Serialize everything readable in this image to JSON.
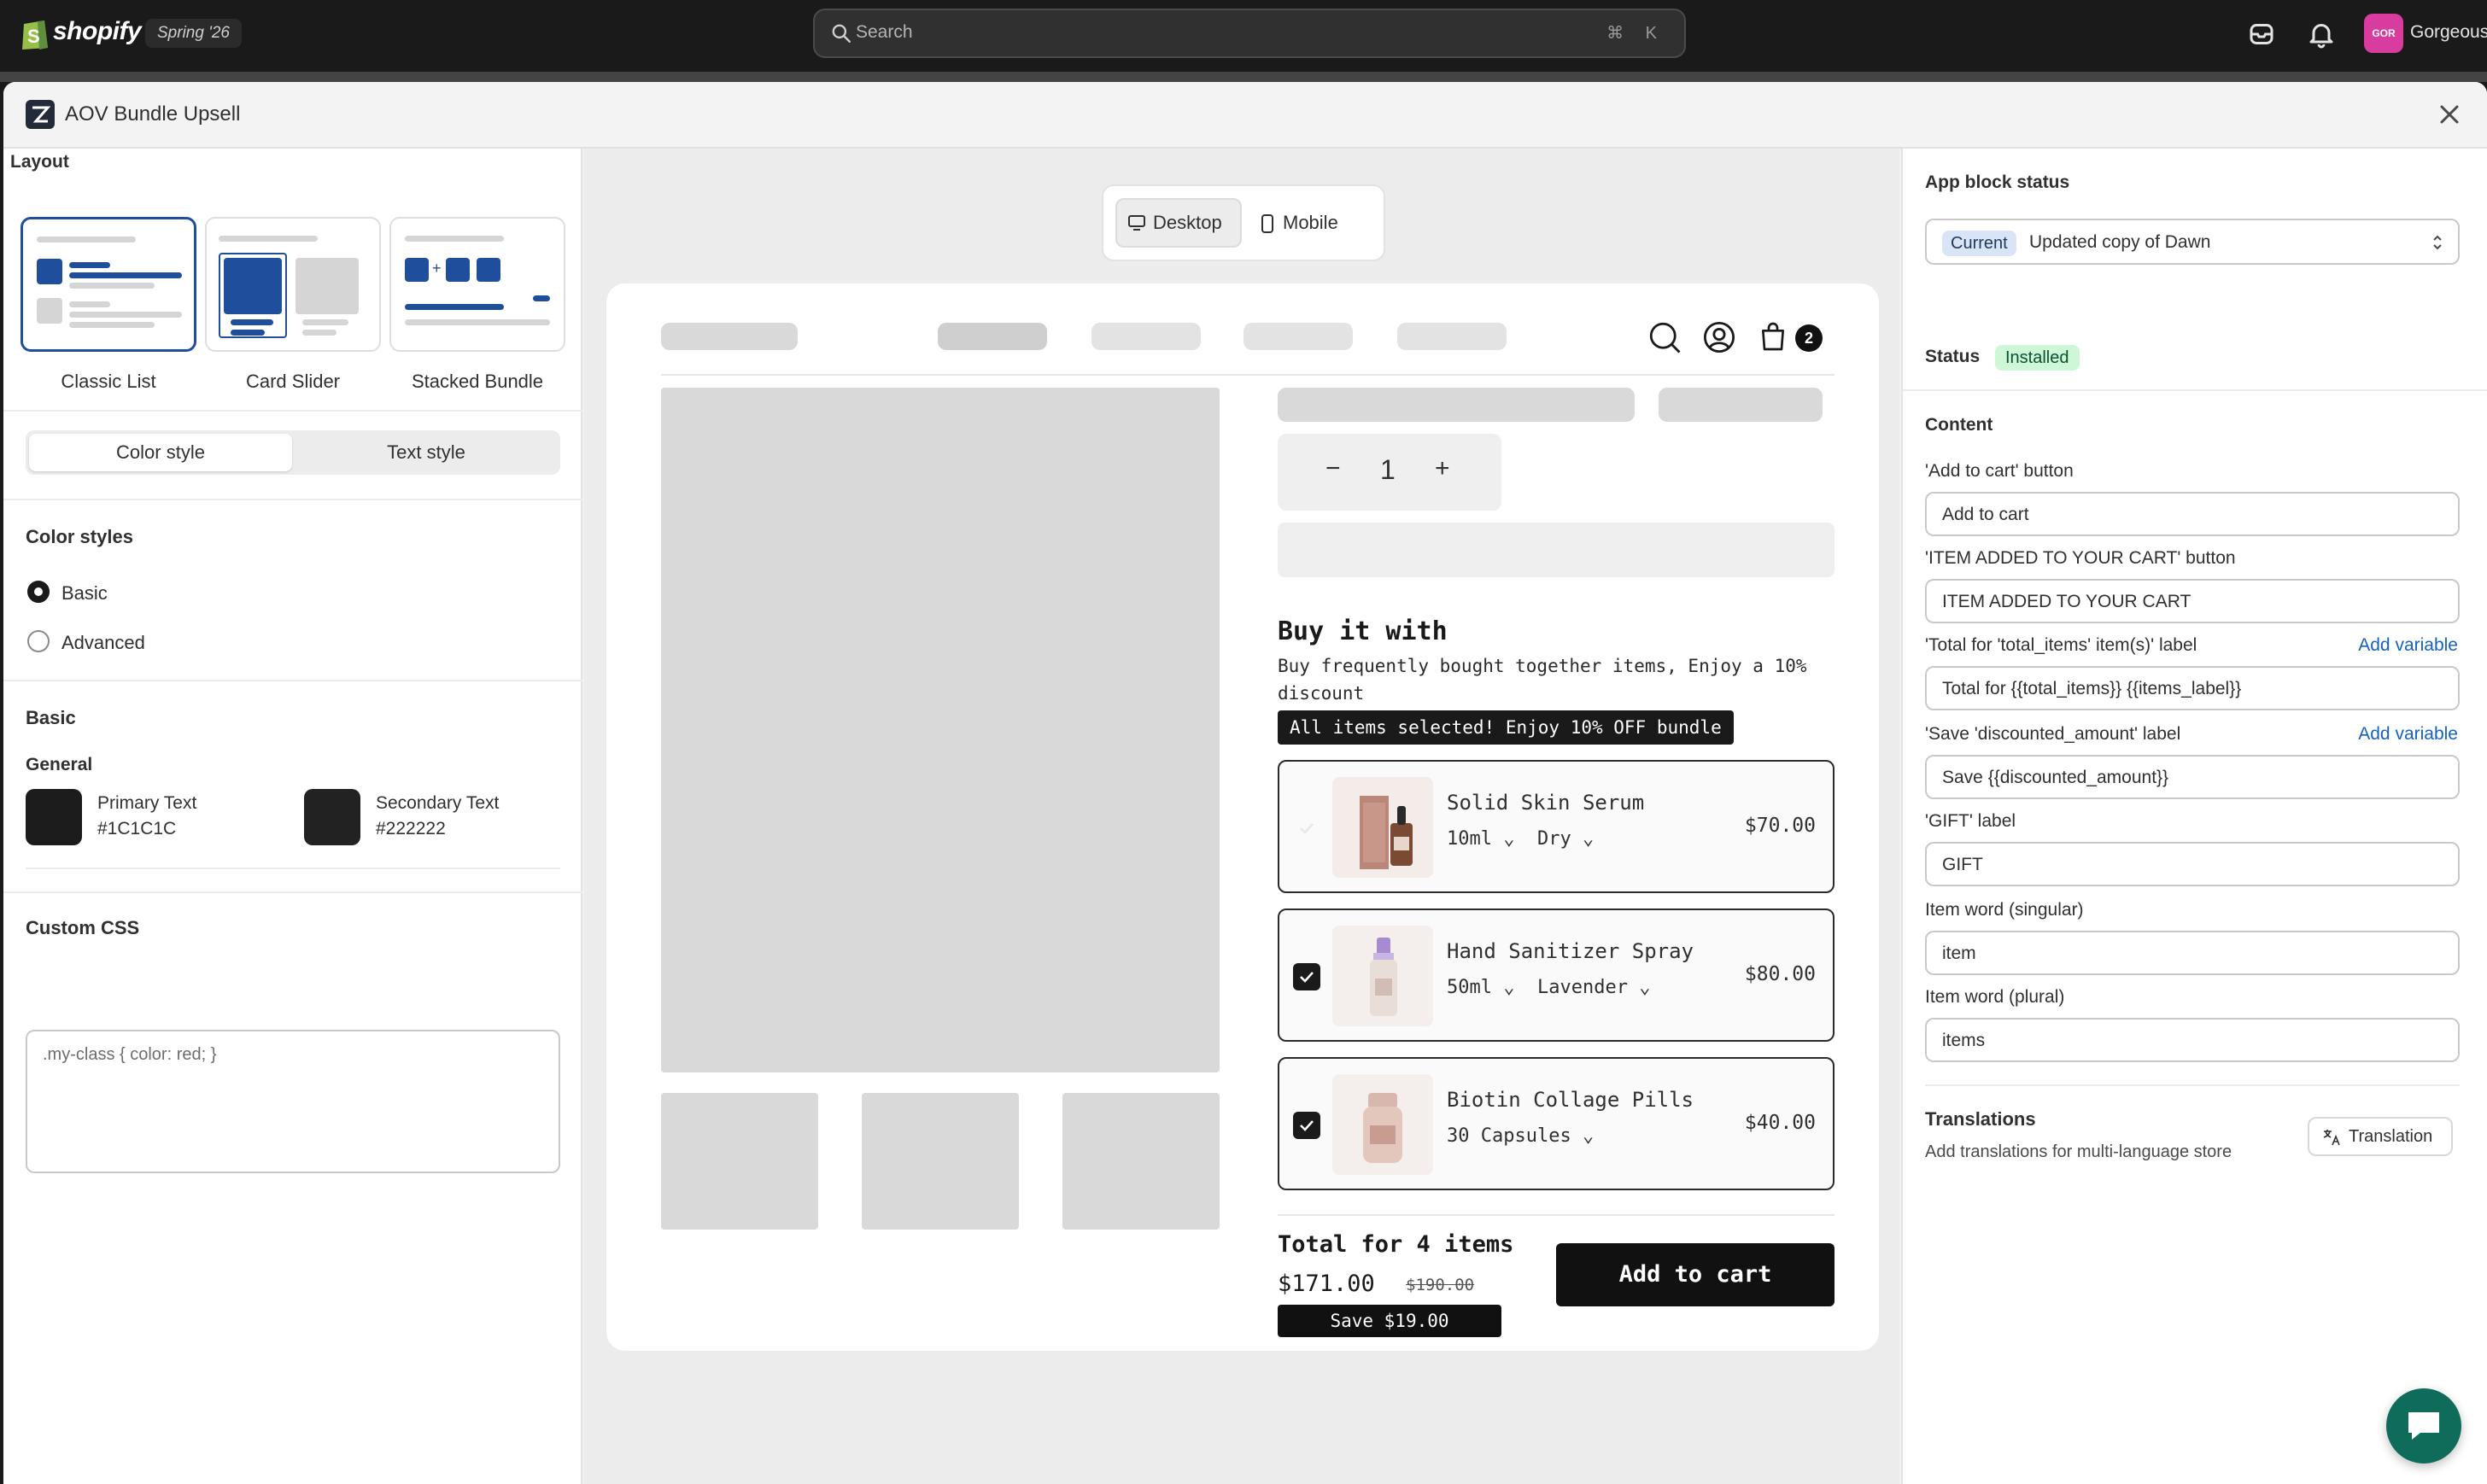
{
  "topbar": {
    "logo": "shopify",
    "edition": "Spring '26",
    "search_placeholder": "Search",
    "search_shortcut": "⌘ K",
    "store_avatar": "GOR",
    "store_name": "Gorgeous"
  },
  "window": {
    "title": "AOV Bundle Upsell"
  },
  "left": {
    "layout_heading": "Layout",
    "layouts": [
      {
        "label": "Classic List",
        "selected": true
      },
      {
        "label": "Card Slider",
        "selected": false
      },
      {
        "label": "Stacked Bundle",
        "selected": false
      }
    ],
    "tabs": {
      "color": "Color style",
      "text": "Text style",
      "active": "Color style"
    },
    "color_styles_heading": "Color styles",
    "color_options": [
      {
        "label": "Basic",
        "checked": true
      },
      {
        "label": "Advanced",
        "checked": false
      }
    ],
    "basic_heading": "Basic",
    "general_heading": "General",
    "swatches": [
      {
        "name": "Primary Text",
        "hex": "#1C1C1C"
      },
      {
        "name": "Secondary Text",
        "hex": "#222222"
      }
    ],
    "custom_css_heading": "Custom CSS",
    "custom_css_placeholder": ".my-class { color: red; }"
  },
  "preview": {
    "device_desktop": "Desktop",
    "device_mobile": "Mobile",
    "active_device": "Desktop",
    "cart_count": "2",
    "quantity": "1",
    "qty_minus": "−",
    "qty_plus": "+",
    "bundle": {
      "heading": "Buy it with",
      "subtitle": "Buy frequently bought together items, Enjoy a 10% discount",
      "banner": "All items selected! Enjoy 10% OFF bundle",
      "items": [
        {
          "name": "Solid Skin Serum",
          "variants": [
            "10ml",
            "Dry"
          ],
          "price": "$70.00",
          "checked": false
        },
        {
          "name": "Hand Sanitizer Spray",
          "variants": [
            "50ml",
            "Lavender"
          ],
          "price": "$80.00",
          "checked": true
        },
        {
          "name": "Biotin Collage Pills",
          "variants": [
            "30 Capsules"
          ],
          "price": "$40.00",
          "checked": true
        }
      ],
      "total_label": "Total for 4 items",
      "total_price": "$171.00",
      "original_price": "$190.00",
      "save_label": "Save $19.00",
      "add_to_cart": "Add to cart"
    }
  },
  "right": {
    "app_block_heading": "App block status",
    "theme_badge": "Current",
    "theme_name": "Updated copy of Dawn",
    "status_label": "Status",
    "status_value": "Installed",
    "content_heading": "Content",
    "fields": [
      {
        "label": "'Add to cart' button",
        "value": "Add to cart",
        "add_variable": ""
      },
      {
        "label": "'ITEM ADDED TO YOUR CART' button",
        "value": "ITEM ADDED TO YOUR CART",
        "add_variable": ""
      },
      {
        "label": "'Total for 'total_items' item(s)' label",
        "value": "Total for {{total_items}} {{items_label}}",
        "add_variable": "Add variable"
      },
      {
        "label": "'Save 'discounted_amount' label",
        "value": "Save {{discounted_amount}}",
        "add_variable": "Add variable"
      },
      {
        "label": "'GIFT' label",
        "value": "GIFT",
        "add_variable": ""
      },
      {
        "label": "Item word (singular)",
        "value": "item",
        "add_variable": ""
      },
      {
        "label": "Item word (plural)",
        "value": "items",
        "add_variable": ""
      }
    ],
    "translations_heading": "Translations",
    "translations_desc": "Add translations for multi-language store",
    "translation_button": "Translation"
  },
  "icons": {
    "search": "search-icon",
    "close": "close-icon",
    "bell": "bell-icon",
    "chat": "chat-icon"
  }
}
